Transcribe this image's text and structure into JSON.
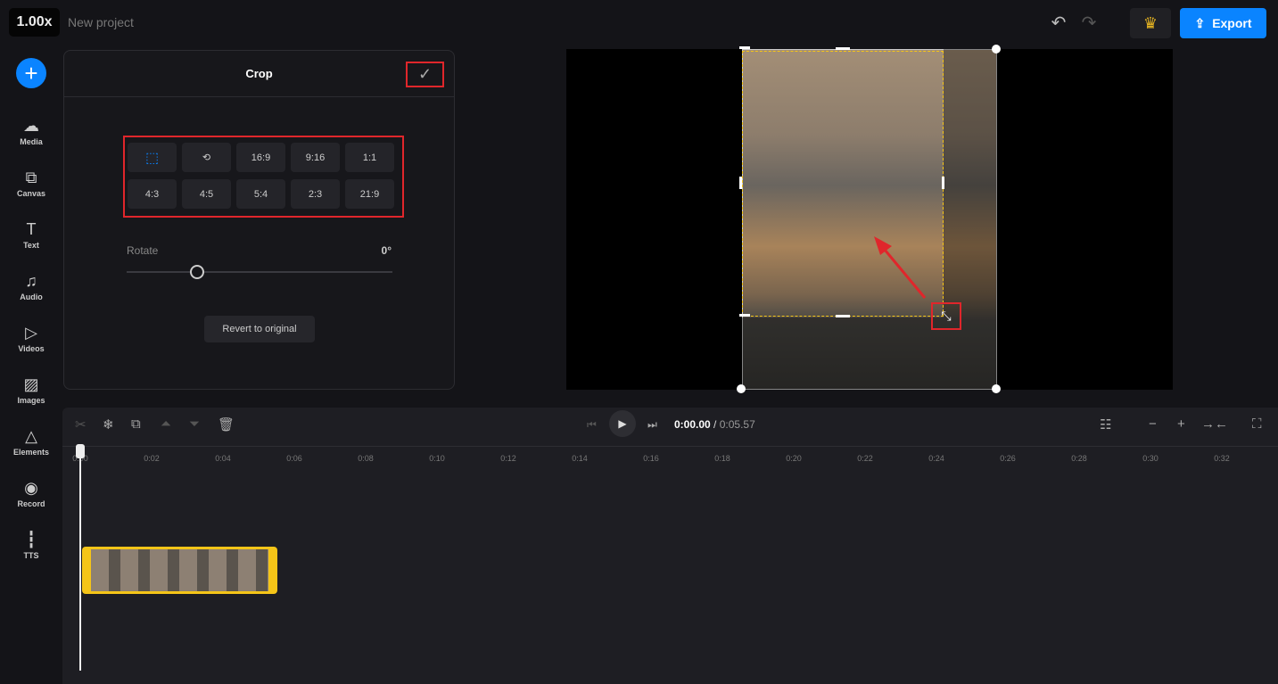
{
  "header": {
    "zoom_badge": "1.00x",
    "project_title": "New project",
    "export_label": "Export",
    "undo_icon": "undo-icon",
    "redo_icon": "redo-icon",
    "premium_icon": "crown-icon"
  },
  "sidebar": {
    "items": [
      {
        "label": "Media",
        "icon": "☁"
      },
      {
        "label": "Canvas",
        "icon": "⧉"
      },
      {
        "label": "Text",
        "icon": "T"
      },
      {
        "label": "Audio",
        "icon": "♫"
      },
      {
        "label": "Videos",
        "icon": "▷"
      },
      {
        "label": "Images",
        "icon": "▨"
      },
      {
        "label": "Elements",
        "icon": "△"
      },
      {
        "label": "Record",
        "icon": "◉"
      },
      {
        "label": "TTS",
        "icon": "┇"
      }
    ]
  },
  "crop": {
    "title": "Crop",
    "ratios": [
      "⬚",
      "⟲",
      "16:9",
      "9:16",
      "1:1",
      "4:3",
      "4:5",
      "5:4",
      "2:3",
      "21:9"
    ],
    "rotate_label": "Rotate",
    "rotate_value": "0°",
    "revert_label": "Revert to original"
  },
  "timeline": {
    "current_time": "0:00.00",
    "separator": "/",
    "duration": "0:05.57",
    "ticks": [
      "0:00",
      "0:02",
      "0:04",
      "0:06",
      "0:08",
      "0:10",
      "0:12",
      "0:14",
      "0:16",
      "0:18",
      "0:20",
      "0:22",
      "0:24",
      "0:26",
      "0:28",
      "0:30",
      "0:32"
    ]
  },
  "colors": {
    "accent": "#0a84ff",
    "highlight": "#e0262b",
    "crop": "#f5c518"
  }
}
